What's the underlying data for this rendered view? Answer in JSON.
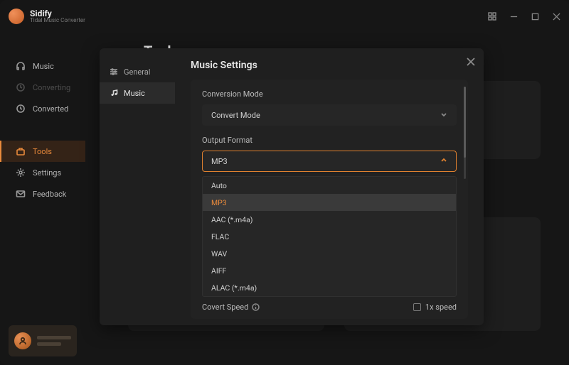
{
  "app": {
    "name": "Sidify",
    "subtitle": "Tidal Music Converter"
  },
  "sidebar": {
    "items": [
      {
        "label": "Music"
      },
      {
        "label": "Converting"
      },
      {
        "label": "Converted"
      },
      {
        "label": "Tools"
      },
      {
        "label": "Settings"
      },
      {
        "label": "Feedback"
      }
    ]
  },
  "main": {
    "heading": "Tools"
  },
  "modal": {
    "tabs": [
      {
        "label": "General"
      },
      {
        "label": "Music"
      }
    ],
    "title": "Music Settings",
    "fields": {
      "conversion_mode": {
        "label": "Conversion Mode",
        "value": "Convert Mode"
      },
      "output_format": {
        "label": "Output Format",
        "value": "MP3",
        "options": [
          "Auto",
          "MP3",
          "AAC (*.m4a)",
          "FLAC",
          "WAV",
          "AIFF",
          "ALAC (*.m4a)"
        ]
      },
      "covert_speed": {
        "label": "Covert Speed",
        "checkbox_label": "1x speed"
      }
    }
  }
}
